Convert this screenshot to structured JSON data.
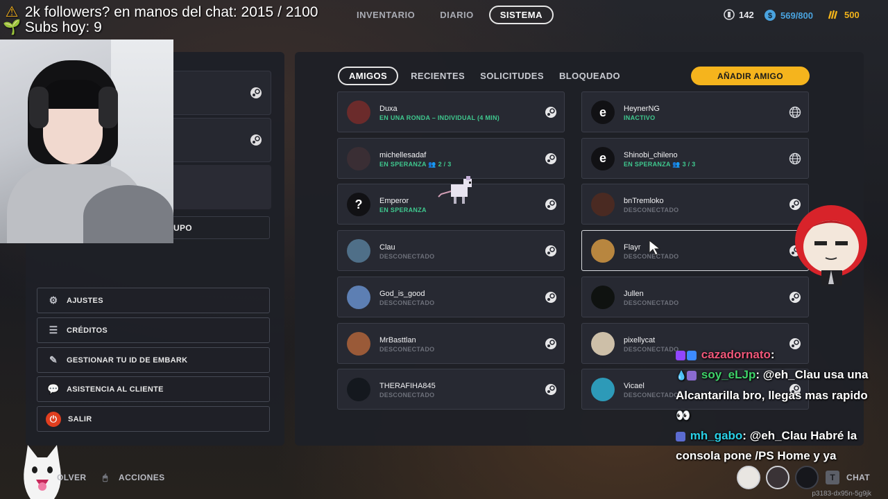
{
  "overlay": {
    "line1_icon": "warning-icon",
    "line1_text": "2k followers? en manos del chat: 2015 / 2100",
    "line2_icon": "sprout-icon",
    "line2_text": "Subs hoy: 9"
  },
  "nav": {
    "tabs": [
      {
        "label": "INVENTARIO",
        "active": false
      },
      {
        "label": "DIARIO",
        "active": false
      },
      {
        "label": "SISTEMA",
        "active": true
      }
    ]
  },
  "currencies": [
    {
      "icon": "coin-icon",
      "value": "142",
      "color": "#d6d7db"
    },
    {
      "icon": "credits-icon",
      "value": "569/800",
      "color": "#4aa3df"
    },
    {
      "icon": "bars-icon",
      "value": "500",
      "color": "#f2b31a"
    }
  ],
  "left_panel": {
    "group_label": "UPO",
    "menu": [
      {
        "label": "AJUSTES",
        "icon": "gear-icon"
      },
      {
        "label": "CRÉDITOS",
        "icon": "list-icon"
      },
      {
        "label": "GESTIONAR TU ID DE EMBARK",
        "icon": "pencil-icon"
      },
      {
        "label": "ASISTENCIA AL CLIENTE",
        "icon": "chat-bubble-icon"
      },
      {
        "label": "SALIR",
        "icon": "power-icon"
      }
    ]
  },
  "friends": {
    "tabs": [
      {
        "label": "AMIGOS",
        "active": true
      },
      {
        "label": "RECIENTES",
        "active": false
      },
      {
        "label": "SOLICITUDES",
        "active": false
      },
      {
        "label": "BLOQUEADO",
        "active": false
      }
    ],
    "add_button": "AÑADIR AMIGO",
    "left_column": [
      {
        "name": "Duxa",
        "status": "EN UNA RONDA – INDIVIDUAL (4 MIN)",
        "online": true,
        "platform": "steam-icon",
        "avatar_color": "#6b2b2b"
      },
      {
        "name": "michellesadaf",
        "status": "EN SPERANZA",
        "party": "2 / 3",
        "online": true,
        "platform": "steam-icon",
        "avatar_color": "#3a2e34"
      },
      {
        "name": "Emperor",
        "status": "EN SPERANZA",
        "online": true,
        "platform": "steam-icon",
        "avatar_color": "#111114",
        "avatar_glyph": "?"
      },
      {
        "name": "Clau",
        "status": "DESCONECTADO",
        "online": false,
        "platform": "steam-icon",
        "avatar_color": "#4f6f88"
      },
      {
        "name": "God_is_good",
        "status": "DESCONECTADO",
        "online": false,
        "platform": "steam-icon",
        "avatar_color": "#5d7fb3"
      },
      {
        "name": "MrBasttlan",
        "status": "DESCONECTADO",
        "online": false,
        "platform": "steam-icon",
        "avatar_color": "#9a5a38"
      },
      {
        "name": "THERAFIHA845",
        "status": "DESCONECTADO",
        "online": false,
        "platform": "steam-icon",
        "avatar_color": "#14181e"
      }
    ],
    "right_column": [
      {
        "name": "HeynerNG",
        "status": "INACTIVO",
        "online": true,
        "platform": "globe-icon",
        "avatar_color": "#111114",
        "avatar_glyph": "e"
      },
      {
        "name": "Shinobi_chileno",
        "status": "EN SPERANZA",
        "party": "3 / 3",
        "online": true,
        "platform": "globe-icon",
        "avatar_color": "#111114",
        "avatar_glyph": "e"
      },
      {
        "name": "bnTremloko",
        "status": "DESCONECTADO",
        "online": false,
        "platform": "steam-icon",
        "avatar_color": "#4a2a22"
      },
      {
        "name": "Flayr",
        "status": "DESCONECTADO",
        "online": false,
        "platform": "steam-icon",
        "avatar_color": "#b8863f",
        "selected": true
      },
      {
        "name": "Jullen",
        "status": "DESCONECTADO",
        "online": false,
        "platform": "steam-icon",
        "avatar_color": "#0f1210"
      },
      {
        "name": "pixellycat",
        "status": "DESCONECTADO",
        "online": false,
        "platform": "steam-icon",
        "avatar_color": "#cdbfa8"
      },
      {
        "name": "Vicael",
        "status": "DESCONECTADO",
        "online": false,
        "platform": "steam-icon",
        "avatar_color": "#2d9ab8"
      }
    ]
  },
  "chat": {
    "messages": [
      {
        "user": "cazadornato",
        "text": ""
      },
      {
        "user": "soy_eLJp",
        "text": "@eh_Clau usa una Alcantarilla bro, llegas mas rapido 👀"
      },
      {
        "user": "mh_gabo",
        "text": "@eh_Clau Habré la consola pone /PS Home y ya"
      }
    ]
  },
  "bottom": {
    "back_label": "OLVER",
    "actions_label": "ACCIONES",
    "chat_key": "T",
    "chat_label": "CHAT",
    "id_code": "p3183-dx95n-5g9jk"
  }
}
